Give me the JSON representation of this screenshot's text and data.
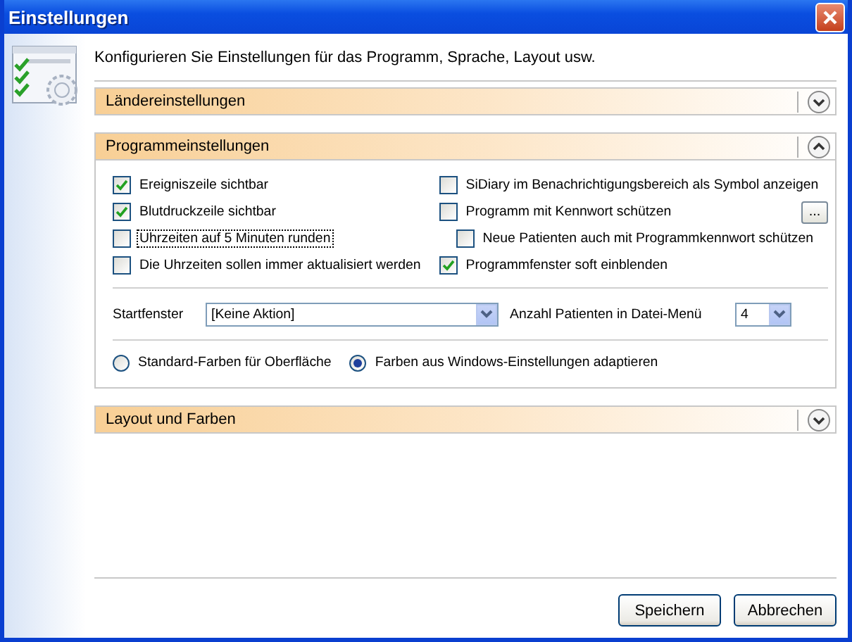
{
  "window": {
    "title": "Einstellungen"
  },
  "intro": "Konfigurieren Sie Einstellungen für das Programm, Sprache, Layout usw.",
  "sections": [
    {
      "title": "Ländereinstellungen",
      "expanded": false
    },
    {
      "title": "Programmeinstellungen",
      "expanded": true,
      "checkboxes_left": [
        {
          "label": "Ereigniszeile sichtbar",
          "checked": true,
          "focused": false
        },
        {
          "label": "Blutdruckzeile sichtbar",
          "checked": true,
          "focused": false
        },
        {
          "label": "Uhrzeiten auf 5 Minuten runden",
          "checked": false,
          "focused": true
        },
        {
          "label": "Die Uhrzeiten sollen immer aktualisiert werden",
          "checked": false,
          "focused": false
        }
      ],
      "checkboxes_right": [
        {
          "label": "SiDiary im Benachrichtigungsbereich als Symbol anzeigen",
          "checked": false,
          "indented": false
        },
        {
          "label": "Programm mit Kennwort schützen",
          "checked": false,
          "indented": false,
          "button": "..."
        },
        {
          "label": "Neue Patienten auch mit Programmkennwort schützen",
          "checked": false,
          "indented": true
        },
        {
          "label": "Programmfenster soft einblenden",
          "checked": true,
          "indented": false
        }
      ],
      "start_window": {
        "label": "Startfenster",
        "value": "[Keine Aktion]"
      },
      "patients_menu": {
        "label": "Anzahl Patienten in Datei-Menü",
        "value": "4"
      },
      "radios": [
        {
          "label": "Standard-Farben für Oberfläche",
          "selected": false
        },
        {
          "label": "Farben aus Windows-Einstellungen adaptieren",
          "selected": true
        }
      ]
    },
    {
      "title": "Layout und Farben",
      "expanded": false
    }
  ],
  "buttons": [
    "Speichern",
    "Abbrechen"
  ]
}
